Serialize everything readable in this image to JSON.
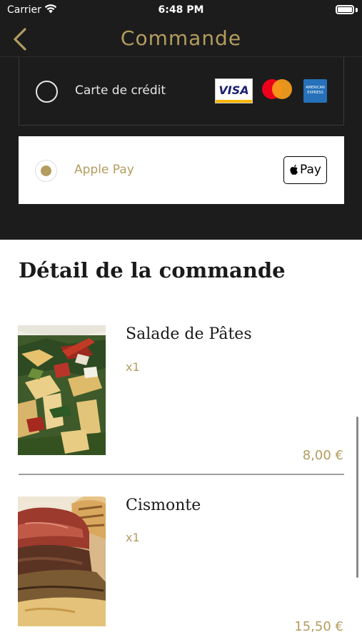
{
  "status_bar": {
    "carrier": "Carrier",
    "time": "6:48 PM"
  },
  "nav": {
    "title": "Commande",
    "back_icon": "chevron-left-icon"
  },
  "payment": {
    "options": [
      {
        "label": "Carte de crédit",
        "selected": false,
        "card_brands": [
          "VISA",
          "Mastercard",
          "American Express"
        ],
        "visa_text": "VISA",
        "amex_text": "AMERICAN EXPRESS"
      },
      {
        "label": "Apple Pay",
        "selected": true,
        "badge_text": "Pay"
      }
    ]
  },
  "order": {
    "title": "Détail de la commande",
    "items": [
      {
        "name": "Salade de Pâtes",
        "quantity": "x1",
        "price": "8,00 €",
        "image": "pasta-salad-photo"
      },
      {
        "name": "Cismonte",
        "quantity": "x1",
        "price": "15,50 €",
        "image": "roast-beef-sandwich-photo"
      }
    ]
  },
  "colors": {
    "accent_gold": "#b39c5f",
    "dark_background": "#1c1c1c",
    "text_dark": "#1a1a1a",
    "divider": "#9e9e9e"
  }
}
